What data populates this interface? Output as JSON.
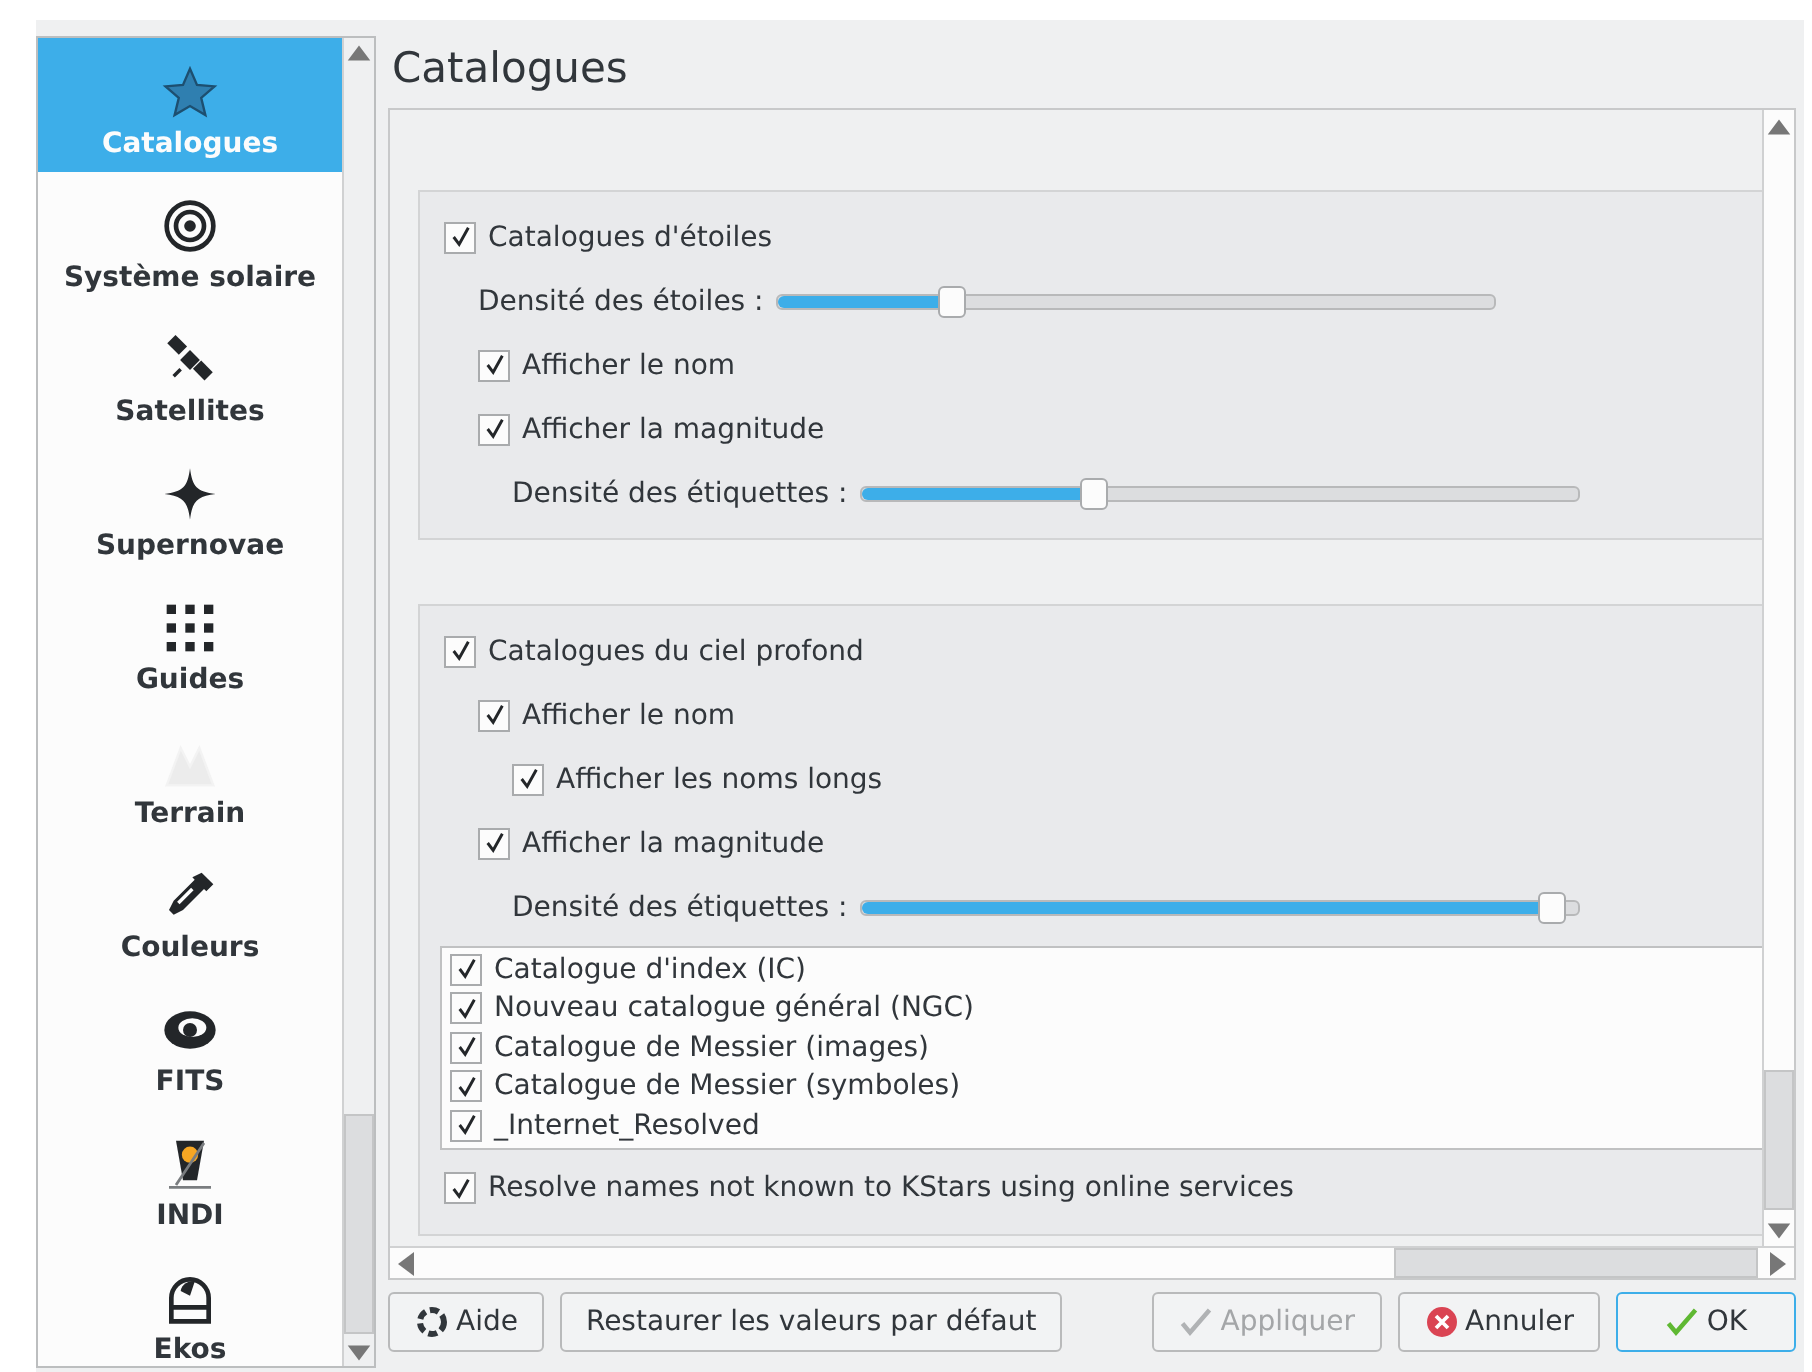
{
  "title": "Catalogues",
  "sidebar": {
    "items": [
      {
        "label": "Catalogues",
        "kind": "star",
        "selected": true
      },
      {
        "label": "Système solaire",
        "kind": "target",
        "selected": false
      },
      {
        "label": "Satellites",
        "kind": "satellite",
        "selected": false
      },
      {
        "label": "Supernovae",
        "kind": "sparkle",
        "selected": false
      },
      {
        "label": "Guides",
        "kind": "grid",
        "selected": false
      },
      {
        "label": "Terrain",
        "kind": "mountain",
        "selected": false
      },
      {
        "label": "Couleurs",
        "kind": "dropper",
        "selected": false
      },
      {
        "label": "FITS",
        "kind": "swirl",
        "selected": false
      },
      {
        "label": "INDI",
        "kind": "telescope",
        "selected": false
      },
      {
        "label": "Ekos",
        "kind": "dome",
        "selected": false
      }
    ]
  },
  "groups": [
    {
      "label": "Catalogues d'étoiles",
      "checked": true,
      "children": [
        {
          "kind": "slider",
          "label": "Densité des étoiles :",
          "level": 0.235
        },
        {
          "kind": "checkbox",
          "label": "Afficher le nom",
          "checked": true
        },
        {
          "kind": "checkbox",
          "label": "Afficher la magnitude",
          "checked": true,
          "children": [
            {
              "kind": "slider",
              "label": "Densité des étiquettes :",
              "level": 0.32
            }
          ]
        }
      ]
    },
    {
      "label": "Catalogues du ciel profond",
      "checked": true,
      "children": [
        {
          "kind": "checkbox",
          "label": "Afficher le nom",
          "checked": true,
          "children": [
            {
              "kind": "checkbox",
              "label": "Afficher les noms longs",
              "checked": true
            }
          ]
        },
        {
          "kind": "checkbox",
          "label": "Afficher la magnitude",
          "checked": true,
          "children": [
            {
              "kind": "slider",
              "label": "Densité des étiquettes :",
              "level": 0.98
            }
          ]
        }
      ],
      "catalog_list": [
        {
          "label": "Catalogue d'index (IC)",
          "checked": true
        },
        {
          "label": "Nouveau catalogue général (NGC)",
          "checked": true
        },
        {
          "label": "Catalogue de Messier (images)",
          "checked": true
        },
        {
          "label": "Catalogue de Messier (symboles)",
          "checked": true
        },
        {
          "label": "_Internet_Resolved",
          "checked": true
        }
      ],
      "footer_checkbox": {
        "label": "Resolve names not known to KStars using online services",
        "checked": true
      }
    }
  ],
  "buttons": [
    {
      "label": "Aide",
      "kind": "help",
      "disabled": false,
      "default": false
    },
    {
      "label": "Restaurer les valeurs par défaut",
      "kind": "plain",
      "disabled": false,
      "default": false
    },
    {
      "label": "Appliquer",
      "kind": "apply",
      "disabled": true,
      "default": false
    },
    {
      "label": "Annuler",
      "kind": "cancel",
      "disabled": false,
      "default": false
    },
    {
      "label": "OK",
      "kind": "ok",
      "disabled": false,
      "default": true
    }
  ]
}
